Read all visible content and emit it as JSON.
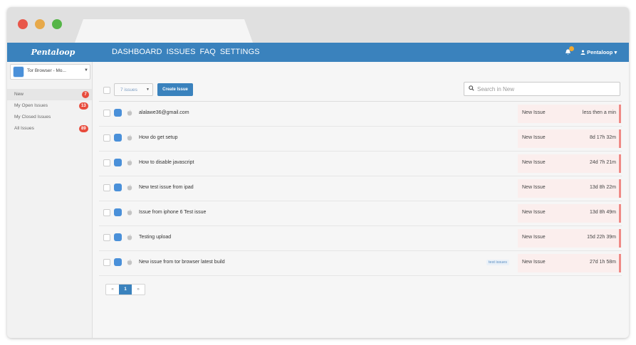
{
  "app": {
    "brand": "Pentaloop"
  },
  "nav": {
    "items": [
      {
        "label": "DASHBOARD"
      },
      {
        "label": "ISSUES"
      },
      {
        "label": "FAQ"
      },
      {
        "label": "SETTINGS"
      }
    ],
    "user": "Pentaloop"
  },
  "sidebar": {
    "project": "Tor Browser - Mo...",
    "items": [
      {
        "label": "New",
        "badge": "7"
      },
      {
        "label": "My Open Issues",
        "badge": "13"
      },
      {
        "label": "My Closed Issues",
        "badge": ""
      },
      {
        "label": "All Issues",
        "badge": "89"
      }
    ]
  },
  "toolbar": {
    "count_label": "7 issues",
    "create_label": "Create Issue",
    "search_placeholder": "Search in New"
  },
  "issues": [
    {
      "title": "alalawe36@gmail.com",
      "tag": "",
      "status": "New Issue",
      "time": "less then a min"
    },
    {
      "title": "How do get setup",
      "tag": "",
      "status": "New Issue",
      "time": "8d 17h 32m"
    },
    {
      "title": "How to disable javascript",
      "tag": "",
      "status": "New Issue",
      "time": "24d 7h 21m"
    },
    {
      "title": "New test issue from ipad",
      "tag": "",
      "status": "New Issue",
      "time": "13d 8h 22m"
    },
    {
      "title": "Issue from iphone 6 Test issue",
      "tag": "",
      "status": "New Issue",
      "time": "13d 8h 49m"
    },
    {
      "title": "Testing upload",
      "tag": "",
      "status": "New Issue",
      "time": "15d 22h 39m"
    },
    {
      "title": "New issue from tor browser latest build",
      "tag": "test issues",
      "status": "New Issue",
      "time": "27d 1h 58m"
    }
  ],
  "pagination": {
    "prev": "«",
    "current": "1",
    "next": "»"
  },
  "colors": {
    "nav_bg": "#3a82bd",
    "badge": "#e84c3d",
    "status_bg": "#fbeeed",
    "flag": "#ef8a86"
  }
}
